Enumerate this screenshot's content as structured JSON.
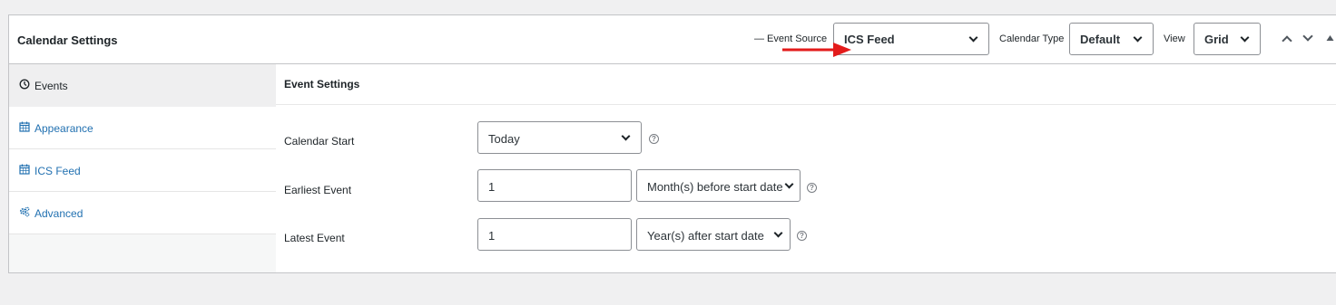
{
  "header": {
    "title": "Calendar Settings",
    "event_source_label": "— Event Source",
    "event_source_value": "ICS Feed",
    "calendar_type_label": "Calendar Type",
    "calendar_type_value": "Default",
    "view_label": "View",
    "view_value": "Grid"
  },
  "sidebar": {
    "tabs": [
      {
        "label": "Events",
        "icon": "clock-icon",
        "active": true
      },
      {
        "label": "Appearance",
        "icon": "calendar-icon",
        "active": false
      },
      {
        "label": "ICS Feed",
        "icon": "calendar-icon",
        "active": false
      },
      {
        "label": "Advanced",
        "icon": "gears-icon",
        "active": false
      }
    ]
  },
  "event_settings": {
    "title": "Event Settings",
    "calendar_start": {
      "label": "Calendar Start",
      "value": "Today"
    },
    "earliest_event": {
      "label": "Earliest Event",
      "number": "1",
      "unit": "Month(s) before start date"
    },
    "latest_event": {
      "label": "Latest Event",
      "number": "1",
      "unit": "Year(s) after start date"
    }
  },
  "colors": {
    "link": "#2271b1",
    "annotation_arrow": "#e31b1b",
    "border": "#c3c4c7"
  }
}
